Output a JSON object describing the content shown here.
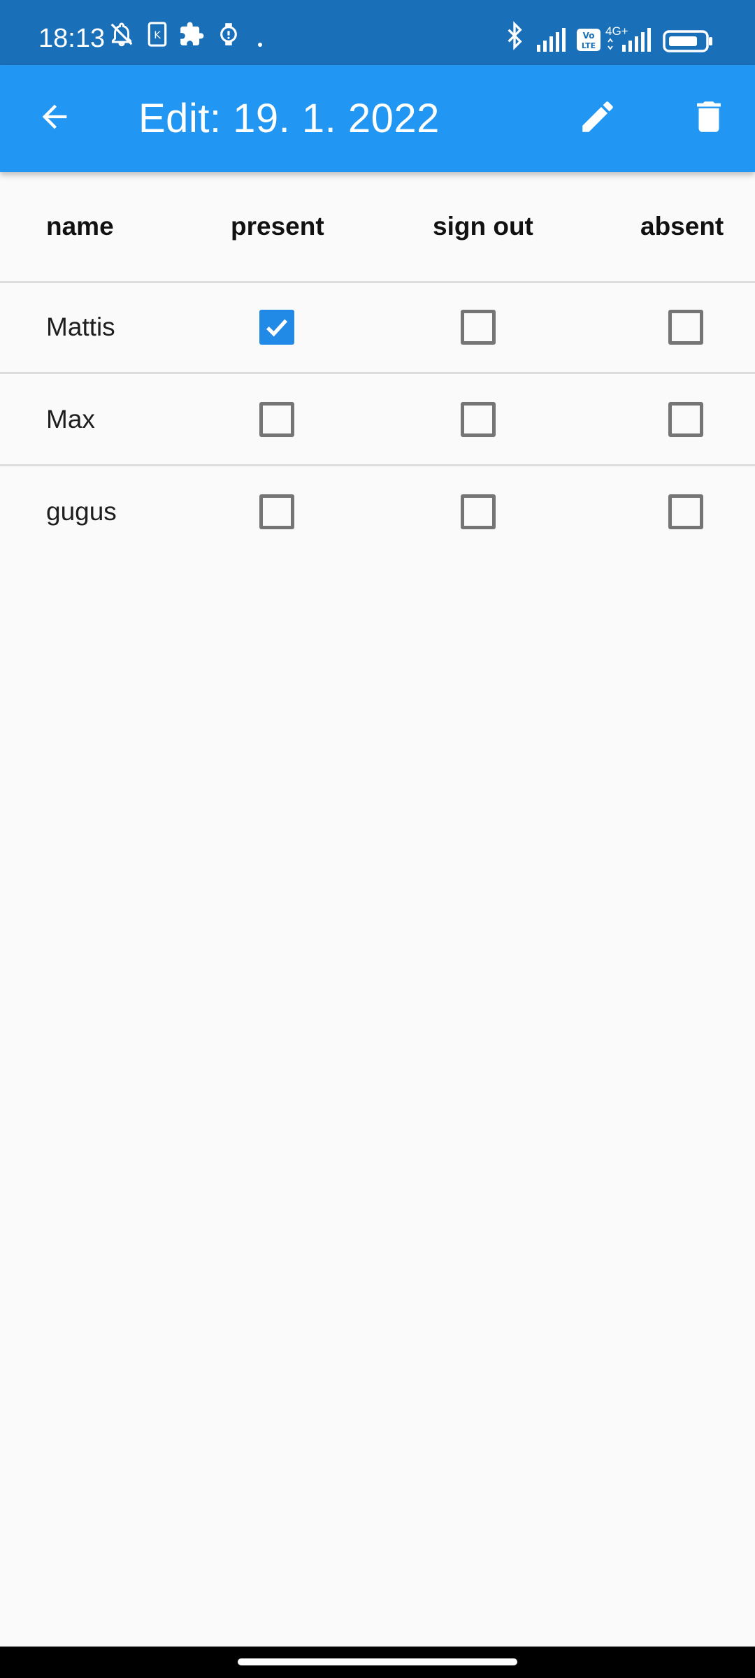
{
  "status_bar": {
    "time": "18:13",
    "left_icons": [
      "bell-off-icon",
      "sim-card-icon",
      "puzzle-icon",
      "watch-alert-icon",
      "dot-icon"
    ],
    "right_icons": [
      "bluetooth-icon",
      "signal-icon",
      "volte-icon",
      "signal-4g-icon",
      "battery-icon"
    ],
    "network_label": "4G+",
    "volte_label": "Vo LTE"
  },
  "app_bar": {
    "title": "Edit: 19. 1. 2022",
    "background": "#2196f3",
    "actions": [
      "back-icon",
      "edit-icon",
      "delete-icon"
    ]
  },
  "table": {
    "columns": [
      "name",
      "present",
      "sign out",
      "absent"
    ],
    "rows": [
      {
        "name": "Mattis",
        "present": true,
        "sign_out": false,
        "absent": false
      },
      {
        "name": "Max",
        "present": false,
        "sign_out": false,
        "absent": false
      },
      {
        "name": "gugus",
        "present": false,
        "sign_out": false,
        "absent": false
      }
    ],
    "checked_color": "#2189e6"
  }
}
